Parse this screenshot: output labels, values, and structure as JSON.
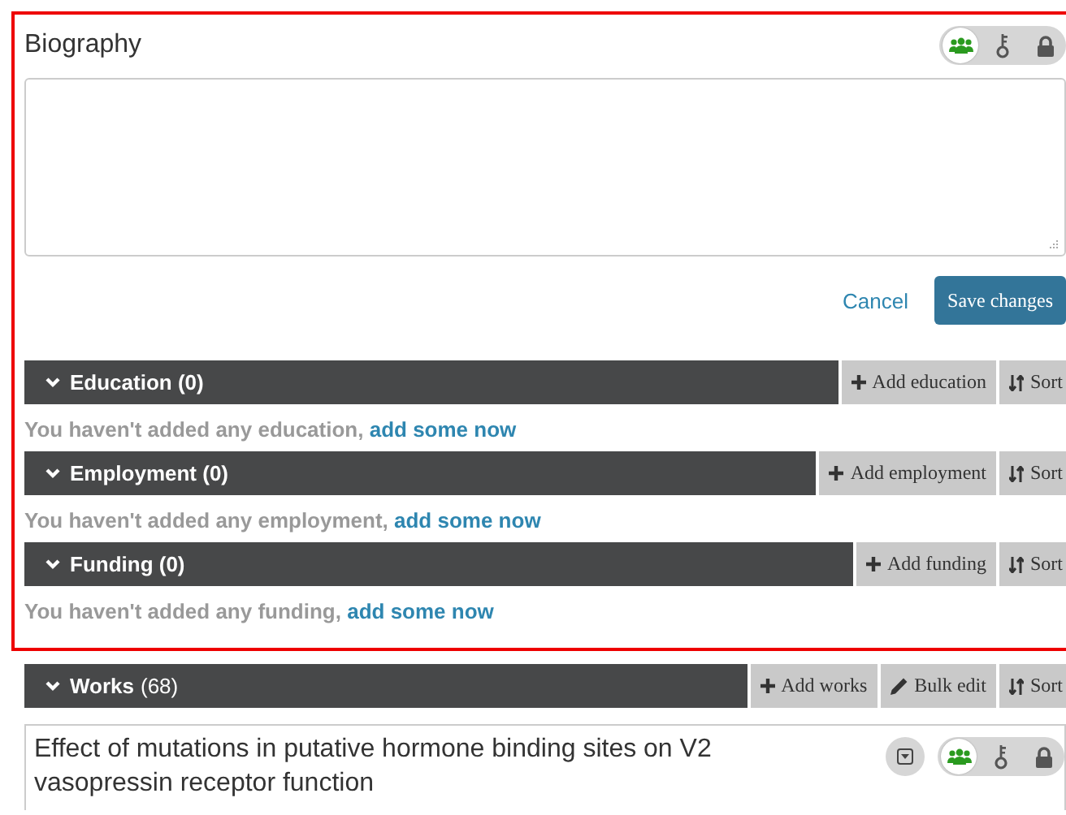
{
  "biography": {
    "title": "Biography",
    "visibility": [
      {
        "kind": "everyone",
        "selected": true
      },
      {
        "kind": "trusted",
        "selected": false
      },
      {
        "kind": "private",
        "selected": false
      }
    ],
    "cancel": "Cancel",
    "save": "Save changes"
  },
  "sections": [
    {
      "title": "Education (0)",
      "buttons": [
        {
          "kind": "add",
          "label": "Add education"
        },
        {
          "kind": "sort",
          "label": "Sort"
        }
      ],
      "empty_message": "You haven't added any education,",
      "empty_link": "add some now"
    },
    {
      "title": "Employment (0)",
      "buttons": [
        {
          "kind": "add",
          "label": "Add employment"
        },
        {
          "kind": "sort",
          "label": "Sort"
        }
      ],
      "empty_message": "You haven't added any employment,",
      "empty_link": "add some now"
    },
    {
      "title": "Funding (0)",
      "buttons": [
        {
          "kind": "add",
          "label": "Add funding"
        },
        {
          "kind": "sort",
          "label": "Sort"
        }
      ],
      "empty_message": "You haven't added any funding,",
      "empty_link": "add some now"
    }
  ],
  "works": {
    "title": "Works",
    "count": "(68)",
    "buttons": [
      {
        "kind": "add",
        "label": "Add works"
      },
      {
        "kind": "edit",
        "label": "Bulk edit"
      },
      {
        "kind": "sort",
        "label": "Sort"
      }
    ],
    "items": [
      {
        "title": "Effect of mutations in putative hormone binding sites on V2 vasopressin receptor function",
        "visibility": [
          {
            "kind": "everyone",
            "selected": true
          },
          {
            "kind": "trusted",
            "selected": false
          },
          {
            "kind": "private",
            "selected": false
          }
        ]
      }
    ]
  }
}
